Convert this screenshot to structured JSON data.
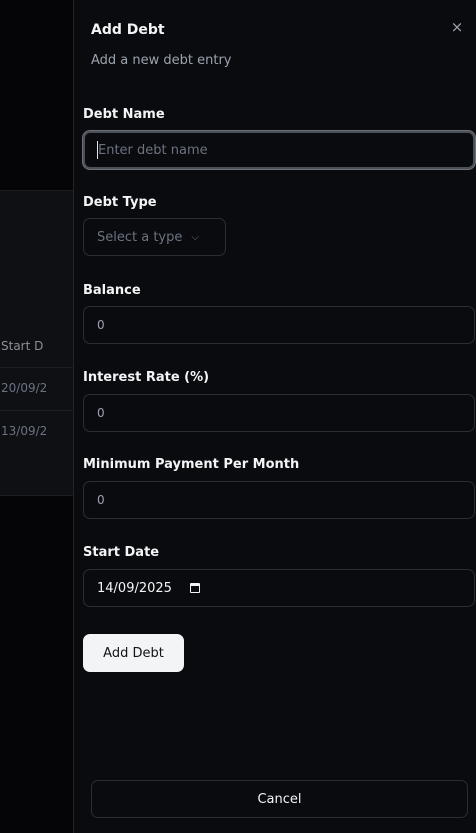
{
  "background": {
    "table_header": "Start D",
    "rows": [
      "20/09/2",
      "13/09/2"
    ]
  },
  "dialog": {
    "title": "Add Debt",
    "subtitle": "Add a new debt entry",
    "close_icon": "×",
    "fields": {
      "debt_name": {
        "label": "Debt Name",
        "placeholder": "Enter debt name",
        "value": ""
      },
      "debt_type": {
        "label": "Debt Type",
        "placeholder": "Select a type",
        "chevron": "⌵"
      },
      "balance": {
        "label": "Balance",
        "placeholder": "0"
      },
      "interest_rate": {
        "label": "Interest Rate (%)",
        "placeholder": "0"
      },
      "minimum_payment": {
        "label": "Minimum Payment Per Month",
        "placeholder": "0"
      },
      "start_date": {
        "label": "Start Date",
        "value": "14/09/2025"
      }
    },
    "submit_label": "Add Debt",
    "cancel_label": "Cancel"
  },
  "colors": {
    "panel_bg": "#0a0b0e",
    "border": "#2a2d35",
    "primary_button_bg": "#f3f4f6",
    "text": "#f3f4f6",
    "muted_text": "#9ca3af"
  },
  "icons": [
    "close-icon",
    "chevron-down-icon",
    "calendar-icon"
  ]
}
